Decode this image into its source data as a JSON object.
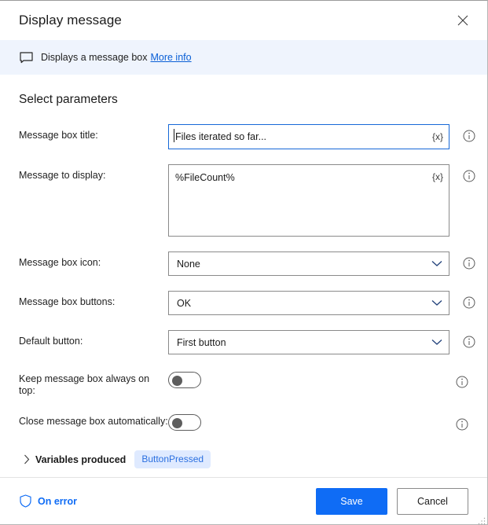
{
  "window": {
    "title": "Display message",
    "close_icon": "close-icon"
  },
  "banner": {
    "icon": "message-box-icon",
    "text": "Displays a message box",
    "link_label": "More info"
  },
  "main": {
    "section_title": "Select parameters",
    "fields": [
      {
        "label": "Message box title:",
        "value": "Files iterated so far...",
        "variable_button": "{x}",
        "info_icon": "info-icon",
        "focused": true
      },
      {
        "label": "Message to display:",
        "value": "%FileCount%",
        "variable_button": "{x}",
        "info_icon": "info-icon",
        "focused": false
      }
    ],
    "dropdowns": [
      {
        "label": "Message box icon:",
        "value": "None",
        "chevron_icon": "chevron-down-icon",
        "info_icon": "info-icon"
      },
      {
        "label": "Message box buttons:",
        "value": "OK",
        "chevron_icon": "chevron-down-icon",
        "info_icon": "info-icon"
      },
      {
        "label": "Default button:",
        "value": "First button",
        "chevron_icon": "chevron-down-icon",
        "info_icon": "info-icon"
      }
    ],
    "toggles": [
      {
        "label": "Keep message box always on top:",
        "state": "off",
        "info_icon": "info-icon"
      },
      {
        "label": "Close message box automatically:",
        "state": "off",
        "info_icon": "info-icon"
      }
    ],
    "variables_produced": {
      "chevron_icon": "chevron-right-icon",
      "label": "Variables produced",
      "chip": "ButtonPressed"
    }
  },
  "footer": {
    "on_error_icon": "shield-icon",
    "on_error_label": "On error",
    "save_label": "Save",
    "cancel_label": "Cancel"
  },
  "colors": {
    "accent": "#0f6cf5",
    "banner_bg": "#eff4fd",
    "link": "#0a5fd6",
    "chip_bg": "#dfeaff",
    "chip_text": "#2a6fe0",
    "focus_border": "#1668d8"
  }
}
